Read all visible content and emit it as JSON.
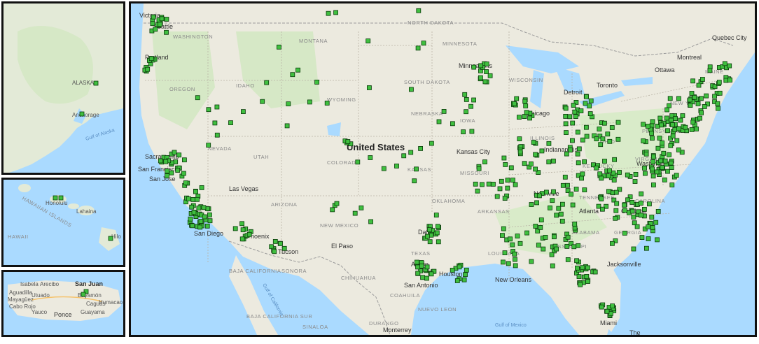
{
  "colors": {
    "water": "#aadaff",
    "land": "#eceadf",
    "green_land": "#cfe6bf",
    "marker_fill": "#3fbf3f",
    "marker_stroke": "#0b3b0b",
    "frame": "#111111"
  },
  "insets": {
    "alaska": {
      "labels": [
        "ALASKA",
        "Anchorage",
        "Gulf of Alaska"
      ]
    },
    "hawaii": {
      "labels": [
        "Honolulu",
        "Lahaina",
        "HAWAII",
        "HAWAIIAN ISLANDS",
        "Hilo"
      ]
    },
    "puerto_rico": {
      "labels": [
        "Isabela",
        "Arecibo",
        "San Juan",
        "Aguadilla",
        "Mayagüez",
        "Cabo Rojo",
        "Bayamón",
        "Humacao",
        "Yauco",
        "Ponce",
        "Guayama",
        "Caguas",
        "Utuado"
      ]
    }
  },
  "main_map": {
    "country_label": "United States",
    "states": [
      "WASHINGTON",
      "MONTANA",
      "NORTH DAKOTA",
      "MINNESOTA",
      "OREGON",
      "IDAHO",
      "WYOMING",
      "SOUTH DAKOTA",
      "WISCONSIN",
      "NEBRASKA",
      "IOWA",
      "NEVADA",
      "UTAH",
      "COLORADO",
      "KANSAS",
      "MISSOURI",
      "ILLINOIS",
      "ARIZONA",
      "NEW MEXICO",
      "OKLAHOMA",
      "ARKANSAS",
      "TEXAS",
      "LOUISIANA",
      "MISSISSIPPI",
      "ALABAMA",
      "GEORGIA",
      "TENNESSEE",
      "KENTUCKY",
      "VIRGINIA",
      "CAROLINA",
      "PENNSYLVANIA",
      "NEW YORK",
      "OHIO",
      "MAINE",
      "SONORA",
      "CHIHUAHUA",
      "COAHUILA",
      "BAJA CALIFORNIA",
      "BAJA CALIFORNIA SUR",
      "SINALOA",
      "DURANGO",
      "NUEVO LEON"
    ],
    "cities": [
      "Victoria",
      "Seattle",
      "Portland",
      "Sacramento",
      "San Francisco",
      "San Jose",
      "Las Vegas",
      "San Diego",
      "Phoenix",
      "Tucson",
      "El Paso",
      "Dallas",
      "San Antonio",
      "Houston",
      "New Orleans",
      "Kansas City",
      "Minneapolis",
      "Chicago",
      "Indianapolis",
      "Nashville",
      "Atlanta",
      "Charlotte",
      "Washington",
      "Jacksonville",
      "Miami",
      "Toronto",
      "Ottawa",
      "Montreal",
      "Quebec City",
      "Monterrey",
      "Austin",
      "Detroit"
    ],
    "water_labels": [
      "Gulf of California",
      "Gulf of Mexico",
      "The"
    ],
    "marker_count_note": "store locations"
  }
}
